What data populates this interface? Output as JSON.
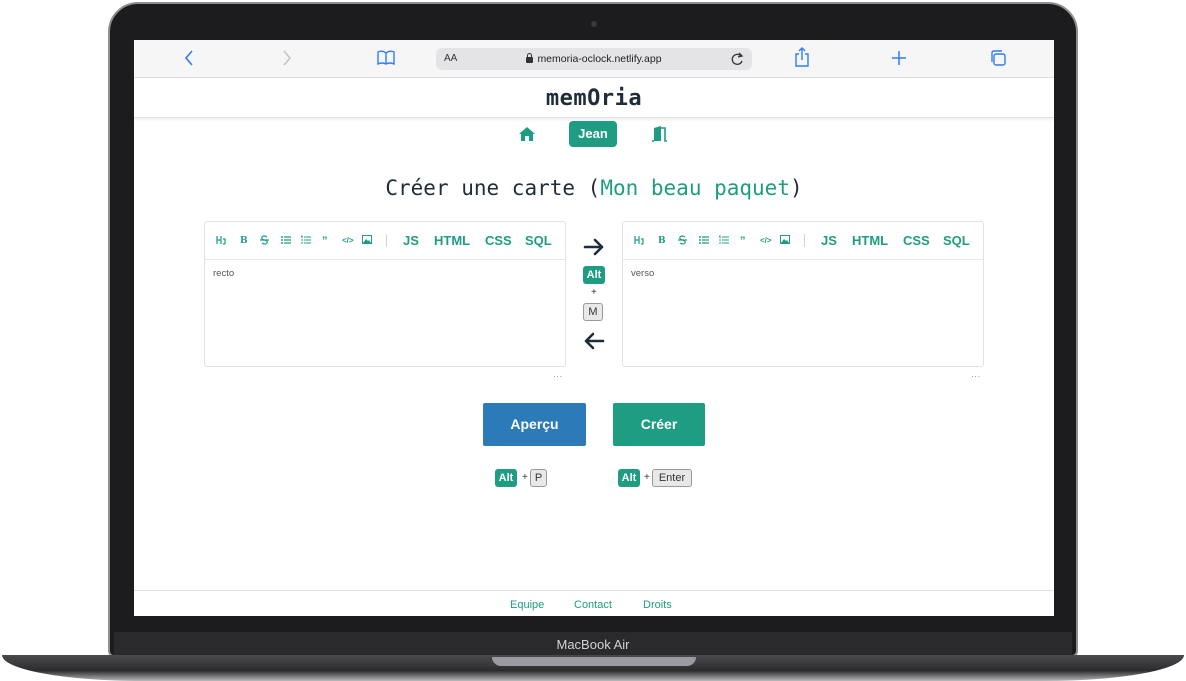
{
  "device": {
    "label": "MacBook Air"
  },
  "browser": {
    "text_size_label": "AA",
    "url": "memoria-oclock.netlify.app"
  },
  "app": {
    "brand": "memOria",
    "nav": {
      "user_label": "Jean"
    }
  },
  "page": {
    "title_prefix": "Créer une carte (",
    "deck_name": "Mon beau paquet",
    "title_suffix": ")"
  },
  "editor": {
    "lang_buttons": [
      "JS",
      "HTML",
      "CSS",
      "SQL"
    ],
    "recto_placeholder": "recto",
    "verso_placeholder": "verso",
    "resize_handle": "..."
  },
  "shortcuts": {
    "alt": "Alt",
    "plus": "+",
    "switch_key": "M",
    "preview_key": "P",
    "create_key": "Enter"
  },
  "actions": {
    "preview_label": "Aperçu",
    "create_label": "Créer"
  },
  "footer": {
    "links": [
      "Equipe",
      "Contact",
      "Droits"
    ]
  },
  "colors": {
    "accent": "#1f9d82",
    "preview_button": "#2d7ab8",
    "text_dark": "#1f2d3a",
    "browser_blue": "#2f7cf6"
  }
}
